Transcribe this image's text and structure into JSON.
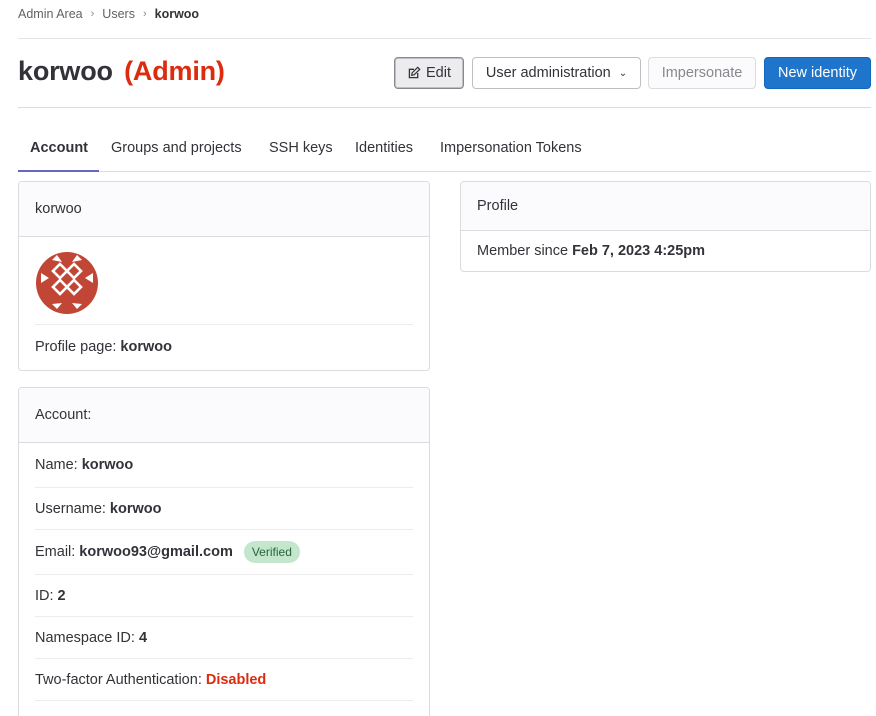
{
  "breadcrumb": [
    "Admin Area",
    "Users",
    "korwoo"
  ],
  "header": {
    "name": "korwoo",
    "admin_label": "(Admin)",
    "buttons": {
      "edit": "Edit",
      "user_admin": "User administration",
      "impersonate": "Impersonate",
      "new_identity": "New identity"
    }
  },
  "tabs": [
    "Account",
    "Groups and projects",
    "SSH keys",
    "Identities",
    "Impersonation Tokens"
  ],
  "user_card": {
    "title": "korwoo",
    "profile_label": "Profile page:",
    "profile_value": "korwoo"
  },
  "profile_card": {
    "title": "Profile",
    "member_label": "Member since",
    "member_value": "Feb 7, 2023 4:25pm"
  },
  "account_card": {
    "title": "Account:",
    "rows": [
      {
        "label": "Name:",
        "value": "korwoo"
      },
      {
        "label": "Username:",
        "value": "korwoo"
      },
      {
        "label": "Email:",
        "value": "korwoo93@gmail.com",
        "badge": "Verified"
      },
      {
        "label": "ID:",
        "value": "2"
      },
      {
        "label": "Namespace ID:",
        "value": "4"
      },
      {
        "label": "Two-factor Authentication:",
        "value": "Disabled"
      }
    ]
  },
  "colors": {
    "admin": "#dd2b0e",
    "primary": "#1f75cb",
    "tab_active": "#6666c4",
    "avatar": "#c24635",
    "badge_bg": "#c3e6cd"
  }
}
